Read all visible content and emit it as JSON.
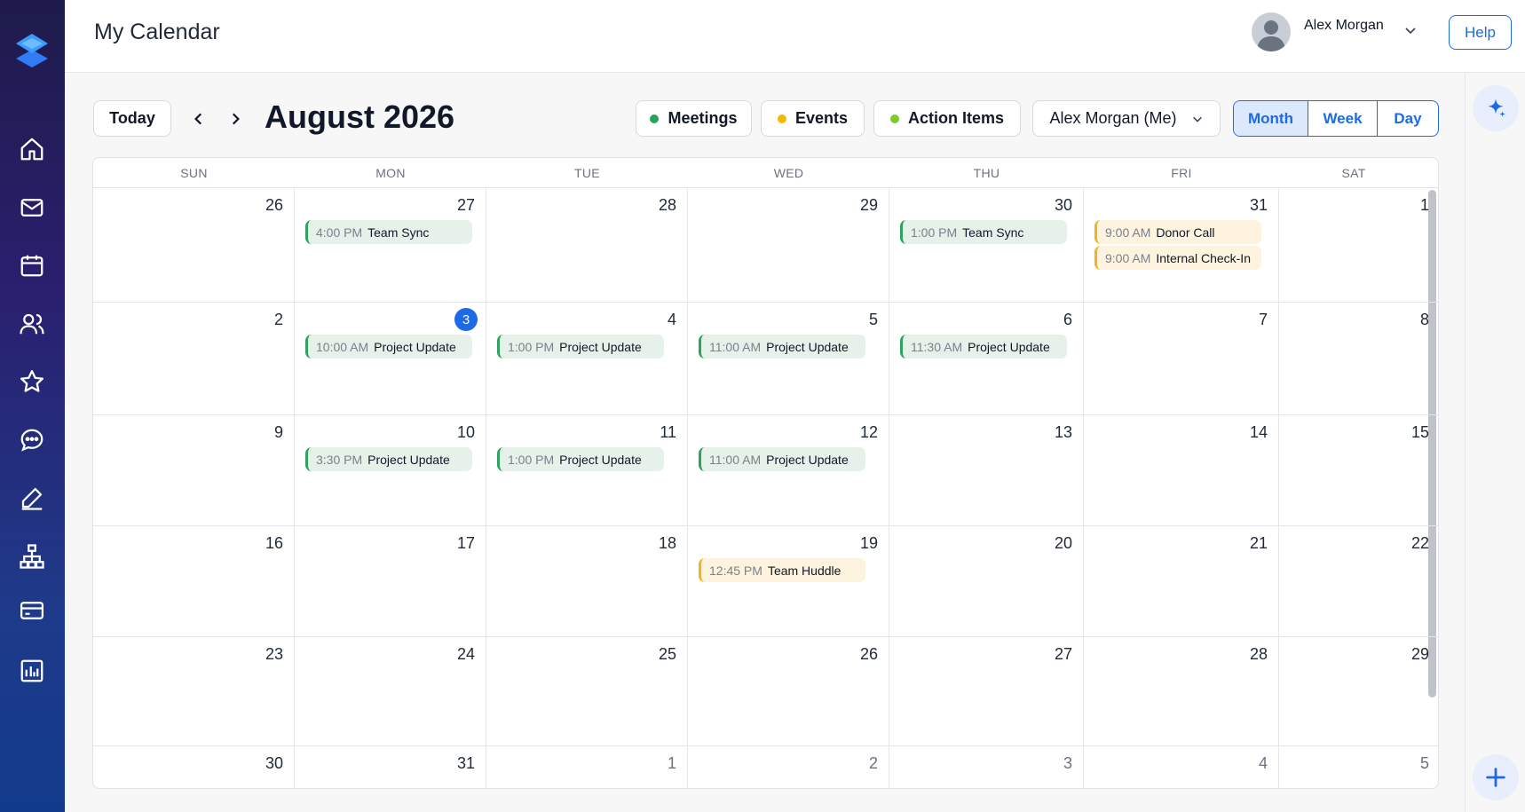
{
  "header": {
    "title": "My Calendar",
    "user_name": "Alex Morgan",
    "help_label": "Help"
  },
  "nav": {
    "items": [
      "home-icon",
      "mail-icon",
      "calendar-icon",
      "people-icon",
      "star-icon",
      "chat-icon",
      "edit-icon",
      "org-chart-icon",
      "card-icon",
      "report-icon"
    ]
  },
  "toolbar": {
    "today_label": "Today",
    "month_title": "August 2026",
    "filters": [
      {
        "label": "Meetings",
        "color": "#27a35a"
      },
      {
        "label": "Events",
        "color": "#f5b800"
      },
      {
        "label": "Action Items",
        "color": "#7ccc2b"
      }
    ],
    "person_select": "Alex Morgan (Me)",
    "views": [
      "Month",
      "Week",
      "Day"
    ],
    "active_view": "Month"
  },
  "calendar": {
    "weekdays": [
      "SUN",
      "MON",
      "TUE",
      "WED",
      "THU",
      "FRI",
      "SAT"
    ],
    "weeks": [
      [
        {
          "day": "26",
          "muted": false,
          "events": []
        },
        {
          "day": "27",
          "muted": false,
          "events": [
            {
              "time": "4:00 PM",
              "title": "Team Sync",
              "color": "green"
            }
          ]
        },
        {
          "day": "28",
          "muted": false,
          "events": []
        },
        {
          "day": "29",
          "muted": false,
          "events": []
        },
        {
          "day": "30",
          "muted": false,
          "events": [
            {
              "time": "1:00 PM",
              "title": "Team Sync",
              "color": "green"
            }
          ]
        },
        {
          "day": "31",
          "muted": false,
          "events": [
            {
              "time": "9:00 AM",
              "title": "Donor Call",
              "color": "yellow"
            },
            {
              "time": "9:00 AM",
              "title": "Internal Check-In",
              "color": "yellow"
            }
          ]
        },
        {
          "day": "1",
          "muted": false,
          "events": []
        }
      ],
      [
        {
          "day": "2",
          "events": []
        },
        {
          "day": "3",
          "today": true,
          "events": [
            {
              "time": "10:00 AM",
              "title": "Project Update",
              "color": "green"
            }
          ]
        },
        {
          "day": "4",
          "events": [
            {
              "time": "1:00 PM",
              "title": "Project Update",
              "color": "green"
            }
          ]
        },
        {
          "day": "5",
          "events": [
            {
              "time": "11:00 AM",
              "title": "Project Update",
              "color": "green"
            }
          ]
        },
        {
          "day": "6",
          "events": [
            {
              "time": "11:30 AM",
              "title": "Project Update",
              "color": "green"
            }
          ]
        },
        {
          "day": "7",
          "events": []
        },
        {
          "day": "8",
          "events": []
        }
      ],
      [
        {
          "day": "9",
          "events": []
        },
        {
          "day": "10",
          "events": [
            {
              "time": "3:30 PM",
              "title": "Project Update",
              "color": "green"
            }
          ]
        },
        {
          "day": "11",
          "events": [
            {
              "time": "1:00 PM",
              "title": "Project Update",
              "color": "green"
            }
          ]
        },
        {
          "day": "12",
          "events": [
            {
              "time": "11:00 AM",
              "title": "Project Update",
              "color": "green"
            }
          ]
        },
        {
          "day": "13",
          "events": []
        },
        {
          "day": "14",
          "events": []
        },
        {
          "day": "15",
          "events": []
        }
      ],
      [
        {
          "day": "16",
          "events": []
        },
        {
          "day": "17",
          "events": []
        },
        {
          "day": "18",
          "events": []
        },
        {
          "day": "19",
          "events": [
            {
              "time": "12:45 PM",
              "title": "Team Huddle",
              "color": "yellow"
            }
          ]
        },
        {
          "day": "20",
          "events": []
        },
        {
          "day": "21",
          "events": []
        },
        {
          "day": "22",
          "events": []
        }
      ],
      [
        {
          "day": "23",
          "events": []
        },
        {
          "day": "24",
          "events": []
        },
        {
          "day": "25",
          "events": []
        },
        {
          "day": "26",
          "events": []
        },
        {
          "day": "27",
          "events": []
        },
        {
          "day": "28",
          "events": []
        },
        {
          "day": "29",
          "events": []
        }
      ],
      [
        {
          "day": "30",
          "events": []
        },
        {
          "day": "31",
          "events": []
        },
        {
          "day": "1",
          "muted": true,
          "events": []
        },
        {
          "day": "2",
          "muted": true,
          "events": []
        },
        {
          "day": "3",
          "muted": true,
          "events": []
        },
        {
          "day": "4",
          "muted": true,
          "events": []
        },
        {
          "day": "5",
          "muted": true,
          "events": []
        }
      ]
    ]
  },
  "colors": {
    "accent": "#1d6ae5",
    "meeting_green": "#2fa35d",
    "event_yellow": "#f2b51d"
  }
}
